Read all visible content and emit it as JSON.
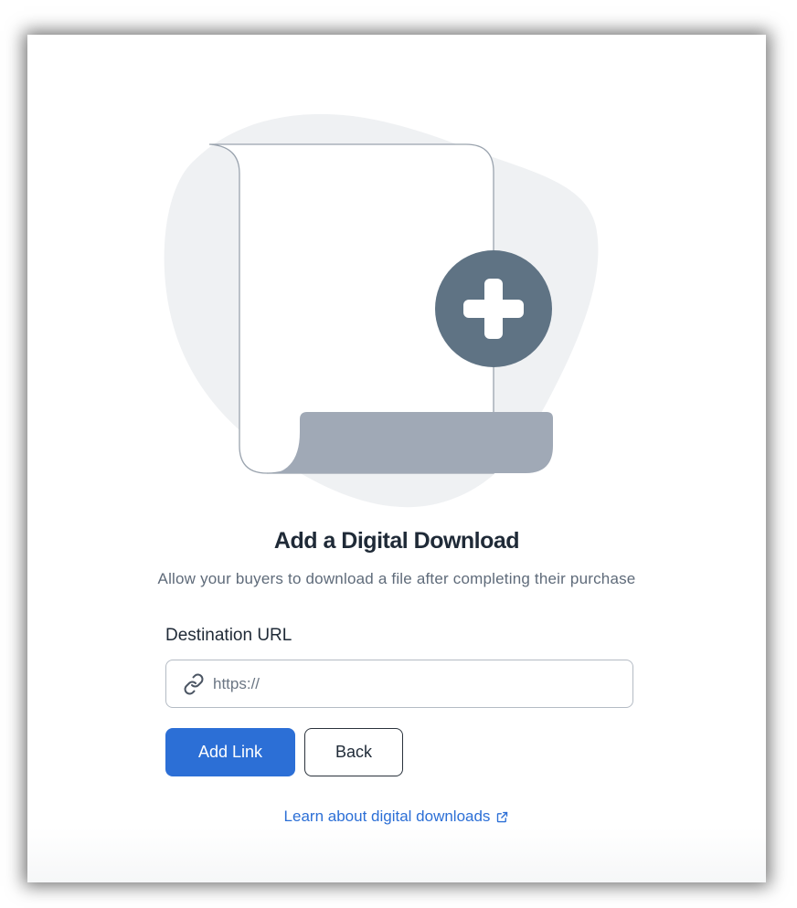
{
  "dialog": {
    "title": "Add a Digital Download",
    "subtitle": "Allow your buyers to download a file after completing their purchase"
  },
  "form": {
    "url_label": "Destination URL",
    "url_placeholder": "https://",
    "url_value": "",
    "url_icon": "link-icon"
  },
  "actions": {
    "add_label": "Add Link",
    "back_label": "Back"
  },
  "help": {
    "link_text": "Learn about digital downloads",
    "link_icon": "external-link-icon"
  },
  "colors": {
    "primary": "#2c6fd6",
    "plus_badge": "#5f7384",
    "scroll_base": "#a0a9b6",
    "blob": "#eff1f3"
  }
}
